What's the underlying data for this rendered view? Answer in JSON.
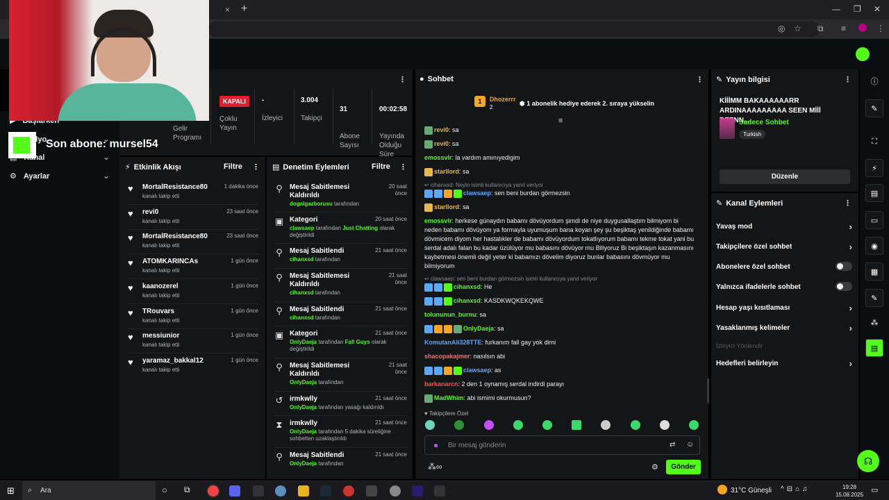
{
  "browser": {
    "close_tab": "×",
    "new_tab": "+",
    "minimize": "—",
    "maximize": "❐",
    "close_window": "✕"
  },
  "subscriber_overlay": {
    "text": "Son abone: mursel54"
  },
  "sidebar": {
    "items": [
      {
        "label": "Başlarken",
        "icon": "play-icon"
      },
      {
        "label": "Radyo",
        "icon": "radio-icon"
      },
      {
        "label": "Kanal",
        "icon": "channel-icon"
      },
      {
        "label": "Ayarlar",
        "icon": "gear-icon"
      }
    ]
  },
  "stats": {
    "gelir": "Gelir\nProgramı",
    "status_badge": "KAPALI",
    "status_label": "Çoklu\nYayın",
    "viewers_value": "-",
    "viewers_label": "İzleyici",
    "followers_value": "3.004",
    "followers_label": "Takipçi",
    "subs_value": "31",
    "subs_label": "Abone\nSayısı",
    "uptime_value": "00:02:58",
    "uptime_label": "Yayında\nOlduğu\nSüre"
  },
  "activity": {
    "title": "Etkinlik Akışı",
    "filter": "Filtre",
    "items": [
      {
        "name": "MortalResistance80",
        "sub": "kanalı takip etti",
        "time": "1 dakika önce"
      },
      {
        "name": "revi0",
        "sub": "kanalı takip etti",
        "time": "23 saat önce"
      },
      {
        "name": "MortalResistance80",
        "sub": "kanalı takip etti",
        "time": "23 saat önce"
      },
      {
        "name": "ATOMKARINCAs",
        "sub": "kanalı takip etti",
        "time": "1 gün önce"
      },
      {
        "name": "kaanozerel",
        "sub": "kanalı takip etti",
        "time": "1 gün önce"
      },
      {
        "name": "TRouvars",
        "sub": "kanalı takip etti",
        "time": "1 gün önce"
      },
      {
        "name": "messiunior",
        "sub": "kanalı takip etti",
        "time": "1 gün önce"
      },
      {
        "name": "yaramaz_bakkal12",
        "sub": "kanalı takip etti",
        "time": "1 gün önce"
      }
    ]
  },
  "moderation": {
    "title": "Denetim Eylemleri",
    "filter": "Filtre",
    "items": [
      {
        "title": "Mesaj Sabitlemesi Kaldırıldı",
        "time": "20 saat önce",
        "user": "dogalgazborusu",
        "rest": " tarafından",
        "extra": "",
        "extra2": ""
      },
      {
        "title": "Kategori",
        "time": "20 saat önce",
        "user": "clawsaep",
        "rest": " tarafından ",
        "extra": "Just Chatting",
        "extra2": " olarak değiştirildi"
      },
      {
        "title": "Mesaj Sabitlendi",
        "time": "21 saat önce",
        "user": "cihanxsd",
        "rest": " tarafından",
        "extra": "",
        "extra2": ""
      },
      {
        "title": "Mesaj Sabitlemesi Kaldırıldı",
        "time": "21 saat önce",
        "user": "cihanxsd",
        "rest": " tarafından",
        "extra": "",
        "extra2": ""
      },
      {
        "title": "Mesaj Sabitlendi",
        "time": "21 saat önce",
        "user": "cihanxsd",
        "rest": " tarafından",
        "extra": "",
        "extra2": ""
      },
      {
        "title": "Kategori",
        "time": "21 saat önce",
        "user": "OnlyDaeja",
        "rest": " tarafından ",
        "extra": "Fall Guys",
        "extra2": " olarak değiştirildi"
      },
      {
        "title": "Mesaj Sabitlemesi Kaldırıldı",
        "time": "21 saat önce",
        "user": "OnlyDaeja",
        "rest": " tarafından",
        "extra": "",
        "extra2": ""
      },
      {
        "title": "irmkwlly",
        "time": "21 saat önce",
        "user": "OnlyDaeja",
        "rest": " tarafından yasağı kaldırıldı",
        "extra": "",
        "extra2": ""
      },
      {
        "title": "irmkwlly",
        "time": "21 saat önce",
        "user": "OnlyDaeja",
        "rest": " tarafından 5 dakika süreliğine sohbetten uzaklaştırıldı",
        "extra": "",
        "extra2": ""
      },
      {
        "title": "Mesaj Sabitlendi",
        "time": "21 saat önce",
        "user": "OnlyDaeja",
        "rest": " tarafından",
        "extra": "",
        "extra2": ""
      }
    ]
  },
  "chat": {
    "title": "Sohbet",
    "pinned_user": "Dhozerrr",
    "pinned_count": "2",
    "gift_text": "1 abonelik hediye ederek 2. sıraya yükselin",
    "followers_only": "Takipçilere Özel",
    "input_placeholder": "Bir mesaj gönderin",
    "send": "Gönder",
    "messages": [
      {
        "user": "revi0",
        "color": "#e8b84a",
        "text": "sa"
      },
      {
        "user": "revi0",
        "color": "#e8b84a",
        "text": "sa"
      },
      {
        "user": "emossvlr",
        "color": "#53fc18",
        "text": "la vardım amınıyedigim"
      },
      {
        "user": "starllord",
        "color": "#e8b84a",
        "text": "sa"
      },
      {
        "reply": "cihanxsd: Neyin isimli kullanıcıya yanıt veriyor",
        "user": "clawsaep",
        "color": "#5aa9ff",
        "text": "sen beni burdan görmezsin"
      },
      {
        "user": "starllord",
        "color": "#e8b84a",
        "text": "sa"
      },
      {
        "user": "emossvlr",
        "color": "#53fc18",
        "text": "herkese günaydın babamı dövüyordum şimdi de niye duygusallaştım bilmiyom bi neden babamı dövüyom ya formayla uyumuşum bana koyan şey şu beşiktaş yenildiğinde babamı dövmicem diyom her hastalıkler de babamı dövüyordum tokatlıyorum babamı tekme tokat yani bu serdal adalı falan bu kadar üzülüyor mu babasını dövüyor mu Biliyoruz Bi beşiktaşın kazanmasını kaybetmesi önemli değil yeter ki babamızı dövelim diyoruz bunlar babasını dövmüyor mu bilmiyorum"
      },
      {
        "reply": "clawsaep: sen beni burdan görmezsin isimli kullanıcıya yanıt veriyor",
        "user": "cihanxsd",
        "color": "#53fc18",
        "text": "He"
      },
      {
        "user": "cihanxsd",
        "color": "#53fc18",
        "text": "KASDKWQKEKQWE"
      },
      {
        "user": "tolununun_burnu",
        "color": "#53fc18",
        "text": "sa"
      },
      {
        "user": "OnlyDaeja",
        "color": "#53fc18",
        "text": "sa"
      },
      {
        "user": "KomutanAli328TTE",
        "color": "#5aa9ff",
        "text": "furkanım fall gay yok dimi"
      },
      {
        "user": "shacopakajmer",
        "color": "#ff6b6b",
        "text": "nasılsın abi"
      },
      {
        "user": "clawsaep",
        "color": "#5aa9ff",
        "text": "as"
      },
      {
        "user": "barkanarcn",
        "color": "#ff4d4d",
        "text": "2 den 1 oynamış serdal indirdi parayı"
      },
      {
        "user": "MadWhim",
        "color": "#53fc18",
        "text": "abi ismimi okurmusun?"
      }
    ]
  },
  "stream_info": {
    "title": "Yayın bilgisi",
    "stream_title": "KİİİMM BAKAAAAAARR ARDINAAAAAAAAA SEEN Mİİİ BEENN...",
    "category": "Sadece Sohbet",
    "tag": "Turkish",
    "edit": "Düzenle"
  },
  "channel_actions": {
    "title": "Kanal Eylemleri",
    "items": [
      {
        "label": "Yavaş mod",
        "type": "chevron"
      },
      {
        "label": "Takipçilere özel sohbet",
        "type": "chevron"
      },
      {
        "label": "Abonelere özel sohbet",
        "type": "toggle"
      },
      {
        "label": "Yalnızca ifadelerle sohbet",
        "type": "toggle"
      },
      {
        "label": "Hesap yaşı kısıtlaması",
        "type": "chevron"
      },
      {
        "label": "Yasaklanmış kelimeler",
        "type": "chevron"
      },
      {
        "label": "İzleyici Yönlendir",
        "type": "disabled"
      },
      {
        "label": "Hedefleri belirleyin",
        "type": "chevron"
      }
    ]
  },
  "taskbar": {
    "search": "Ara",
    "weather": "31°C  Güneşli",
    "time": "19:28",
    "date": "15.08.2025"
  },
  "colors": {
    "kick_green": "#53fc18",
    "panel_bg": "#141517",
    "live_red": "#e11d2f"
  }
}
